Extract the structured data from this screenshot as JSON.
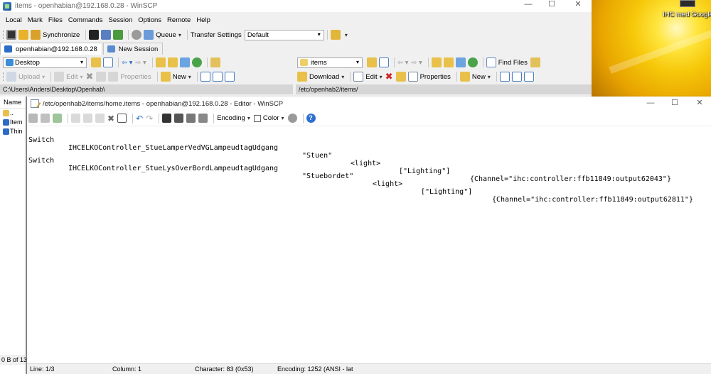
{
  "main_window": {
    "title": "items - openhabian@192.168.0.28 - WinSCP"
  },
  "menu": [
    "Local",
    "Mark",
    "Files",
    "Commands",
    "Session",
    "Options",
    "Remote",
    "Help"
  ],
  "toolbar1": {
    "synchronize": "Synchronize",
    "queue": "Queue",
    "transfer_settings_label": "Transfer Settings",
    "transfer_settings_value": "Default"
  },
  "tabs": {
    "session": "openhabian@192.168.0.28",
    "new_session": "New Session"
  },
  "local_panel": {
    "location": "Desktop",
    "upload": "Upload",
    "edit": "Edit",
    "properties": "Properties",
    "new": "New",
    "path": "C:\\Users\\Anders\\Desktop\\Openhab\\",
    "column_name": "Name",
    "rows": [
      "..",
      "Item",
      "Thin"
    ],
    "status": "0 B of 13"
  },
  "remote_panel": {
    "location": "items",
    "find_files": "Find Files",
    "download": "Download",
    "edit": "Edit",
    "properties": "Properties",
    "new": "New",
    "path": "/etc/openhab2/items/"
  },
  "desktop": {
    "shortcut_label": "IHC med Google"
  },
  "editor": {
    "title": "/etc/openhab2/items/home.items - openhabian@192.168.0.28 - Editor - WinSCP",
    "encoding_label": "Encoding",
    "color_label": "Color",
    "lines": [
      {
        "type": "Switch",
        "name": "IHCELKOController_StueLamperVedVGLampeudtagUdgang",
        "label": "\"Stuen\"",
        "icon": "<light>",
        "group": "[\"Lighting\"]",
        "channel": "{Channel=\"ihc:controller:ffb11849:output62043\"}"
      },
      {
        "type": "Switch",
        "name": "IHCELKOController_StueLysOverBordLampeudtagUdgang",
        "label": "\"Stuebordet\"",
        "icon": "<light>",
        "group": "[\"Lighting\"]",
        "channel": "{Channel=\"ihc:controller:ffb11849:output62811\"}"
      }
    ],
    "status": {
      "line": "Line: 1/3",
      "column": "Column: 1",
      "character": "Character: 83 (0x53)",
      "encoding": "Encoding: 1252  (ANSI - lat"
    }
  }
}
